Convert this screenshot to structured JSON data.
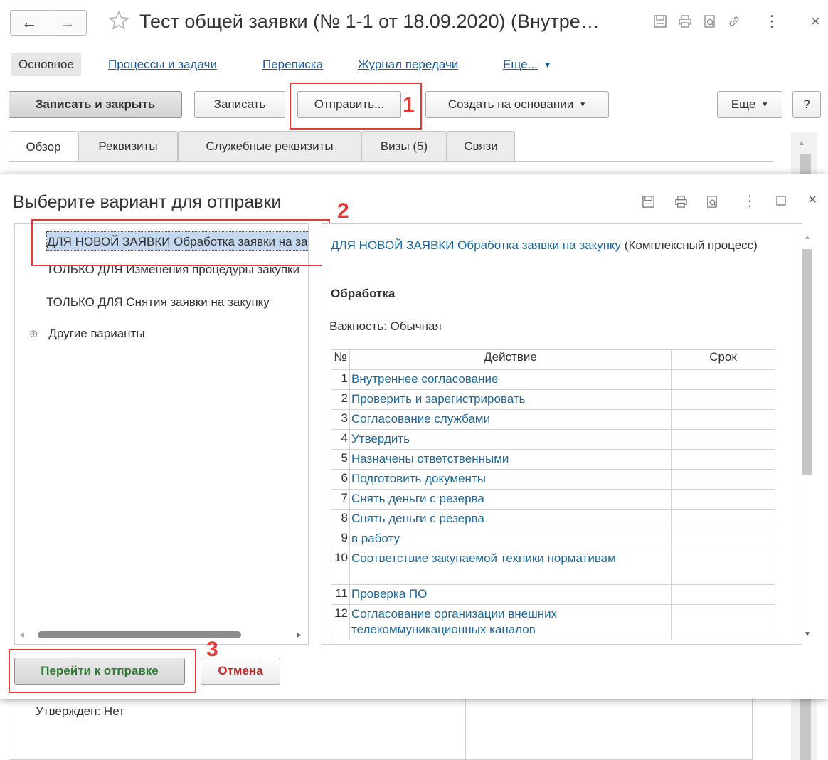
{
  "window": {
    "title": "Тест общей заявки (№ 1-1 от 18.09.2020) (Внутре…",
    "more_icon": "⋮",
    "close_icon": "×"
  },
  "subnav": {
    "items": [
      "Основное",
      "Процессы и задачи",
      "Переписка",
      "Журнал передачи",
      "Еще..."
    ]
  },
  "toolbar": {
    "save_close": "Записать и закрыть",
    "save": "Записать",
    "send": "Отправить...",
    "create_based": "Создать на основании",
    "more": "Еще",
    "help": "?"
  },
  "tabs": [
    "Обзор",
    "Реквизиты",
    "Служебные реквизиты",
    "Визы (5)",
    "Связи"
  ],
  "markers": [
    "1",
    "2",
    "3"
  ],
  "dialog": {
    "title": "Выберите вариант для отправки",
    "variants": [
      "ДЛЯ НОВОЙ ЗАЯВКИ Обработка заявки на закупку",
      "ТОЛЬКО ДЛЯ Изменения процедуры закупки",
      "ТОЛЬКО ДЛЯ Снятия заявки на закупку"
    ],
    "other_variants": "Другие варианты",
    "expand_icon": "⊕",
    "detail": {
      "process_link": "ДЛЯ НОВОЙ ЗАЯВКИ Обработка заявки на закупку",
      "process_type": "(Комплексный процесс)",
      "section": "Обработка",
      "importance": "Важность: Обычная",
      "table_headers": [
        "№",
        "Действие",
        "Срок"
      ],
      "rows": [
        {
          "n": "1",
          "action": "Внутреннее согласование"
        },
        {
          "n": "2",
          "action": "Проверить и зарегистрировать"
        },
        {
          "n": "3",
          "action": "Согласование службами"
        },
        {
          "n": "4",
          "action": "Утвердить"
        },
        {
          "n": "5",
          "action": "Назначены ответственными"
        },
        {
          "n": "6",
          "action": "Подготовить документы"
        },
        {
          "n": "7",
          "action": "Снять деньги с резерва"
        },
        {
          "n": "8",
          "action": "Снять деньги с резерва"
        },
        {
          "n": "9",
          "action": "в работу"
        },
        {
          "n": "10",
          "action": "Соответствие закупаемой техники нормативам"
        },
        {
          "n": "11",
          "action": "Проверка ПО"
        },
        {
          "n": "12",
          "action": "Согласование организации внешних телекоммуникационных каналов"
        }
      ]
    },
    "buttons": {
      "go_send": "Перейти к отправке",
      "cancel": "Отмена"
    }
  },
  "background": {
    "approved": "Утвержден: Нет"
  },
  "colors": {
    "link": "#1a6aa0",
    "marker": "#e53935",
    "go_send": "#2e7d32",
    "cancel": "#c62828",
    "selection": "#c4d8ef"
  }
}
